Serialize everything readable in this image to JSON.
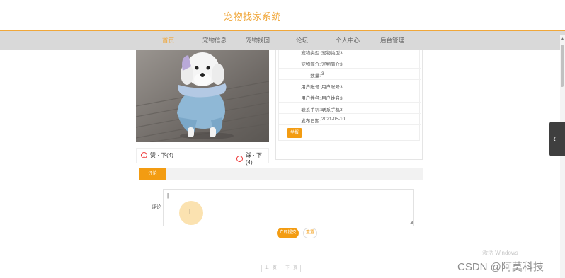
{
  "header": {
    "site_title": "宠物找家系统"
  },
  "nav": {
    "items": [
      {
        "label": "首页"
      },
      {
        "label": "宠物信息"
      },
      {
        "label": "宠物找回"
      },
      {
        "label": "论坛"
      },
      {
        "label": "个人中心"
      },
      {
        "label": "后台管理"
      }
    ],
    "active_label": "首页",
    "active_color": "#f0a73a"
  },
  "vote": {
    "up_label": "赞 · 下(4)",
    "down_label": "踩 · 下(4)"
  },
  "detail": {
    "rows": [
      {
        "key": "宠物类型:",
        "value": "宠物类型3"
      },
      {
        "key": "宠物简介:",
        "value": "宠物简介3"
      },
      {
        "key": "数量:",
        "value": "3"
      },
      {
        "key": "用户账号:",
        "value": "用户账号3"
      },
      {
        "key": "用户姓名:",
        "value": "用户姓名3"
      },
      {
        "key": "联系手机:",
        "value": "联系手机3"
      },
      {
        "key": "发布日期:",
        "value": "2021-05-10"
      }
    ],
    "report_button": "举报"
  },
  "comments": {
    "tab_label": "评论",
    "field_label": "评论",
    "field_value": "|",
    "submit_button": "立即提交",
    "reset_button": "重置",
    "accent_color": "#f39c12"
  },
  "pagination": {
    "prev": "上一页",
    "next": "下一页"
  },
  "watermarks": {
    "windows": "激活 Windows",
    "csdn": "CSDN @阿莫科技"
  },
  "icons": {
    "smile": "smile-icon",
    "chevron_left": "chevron-left-icon",
    "ibeam": "text-cursor-icon",
    "resize": "resize-grip-icon"
  }
}
